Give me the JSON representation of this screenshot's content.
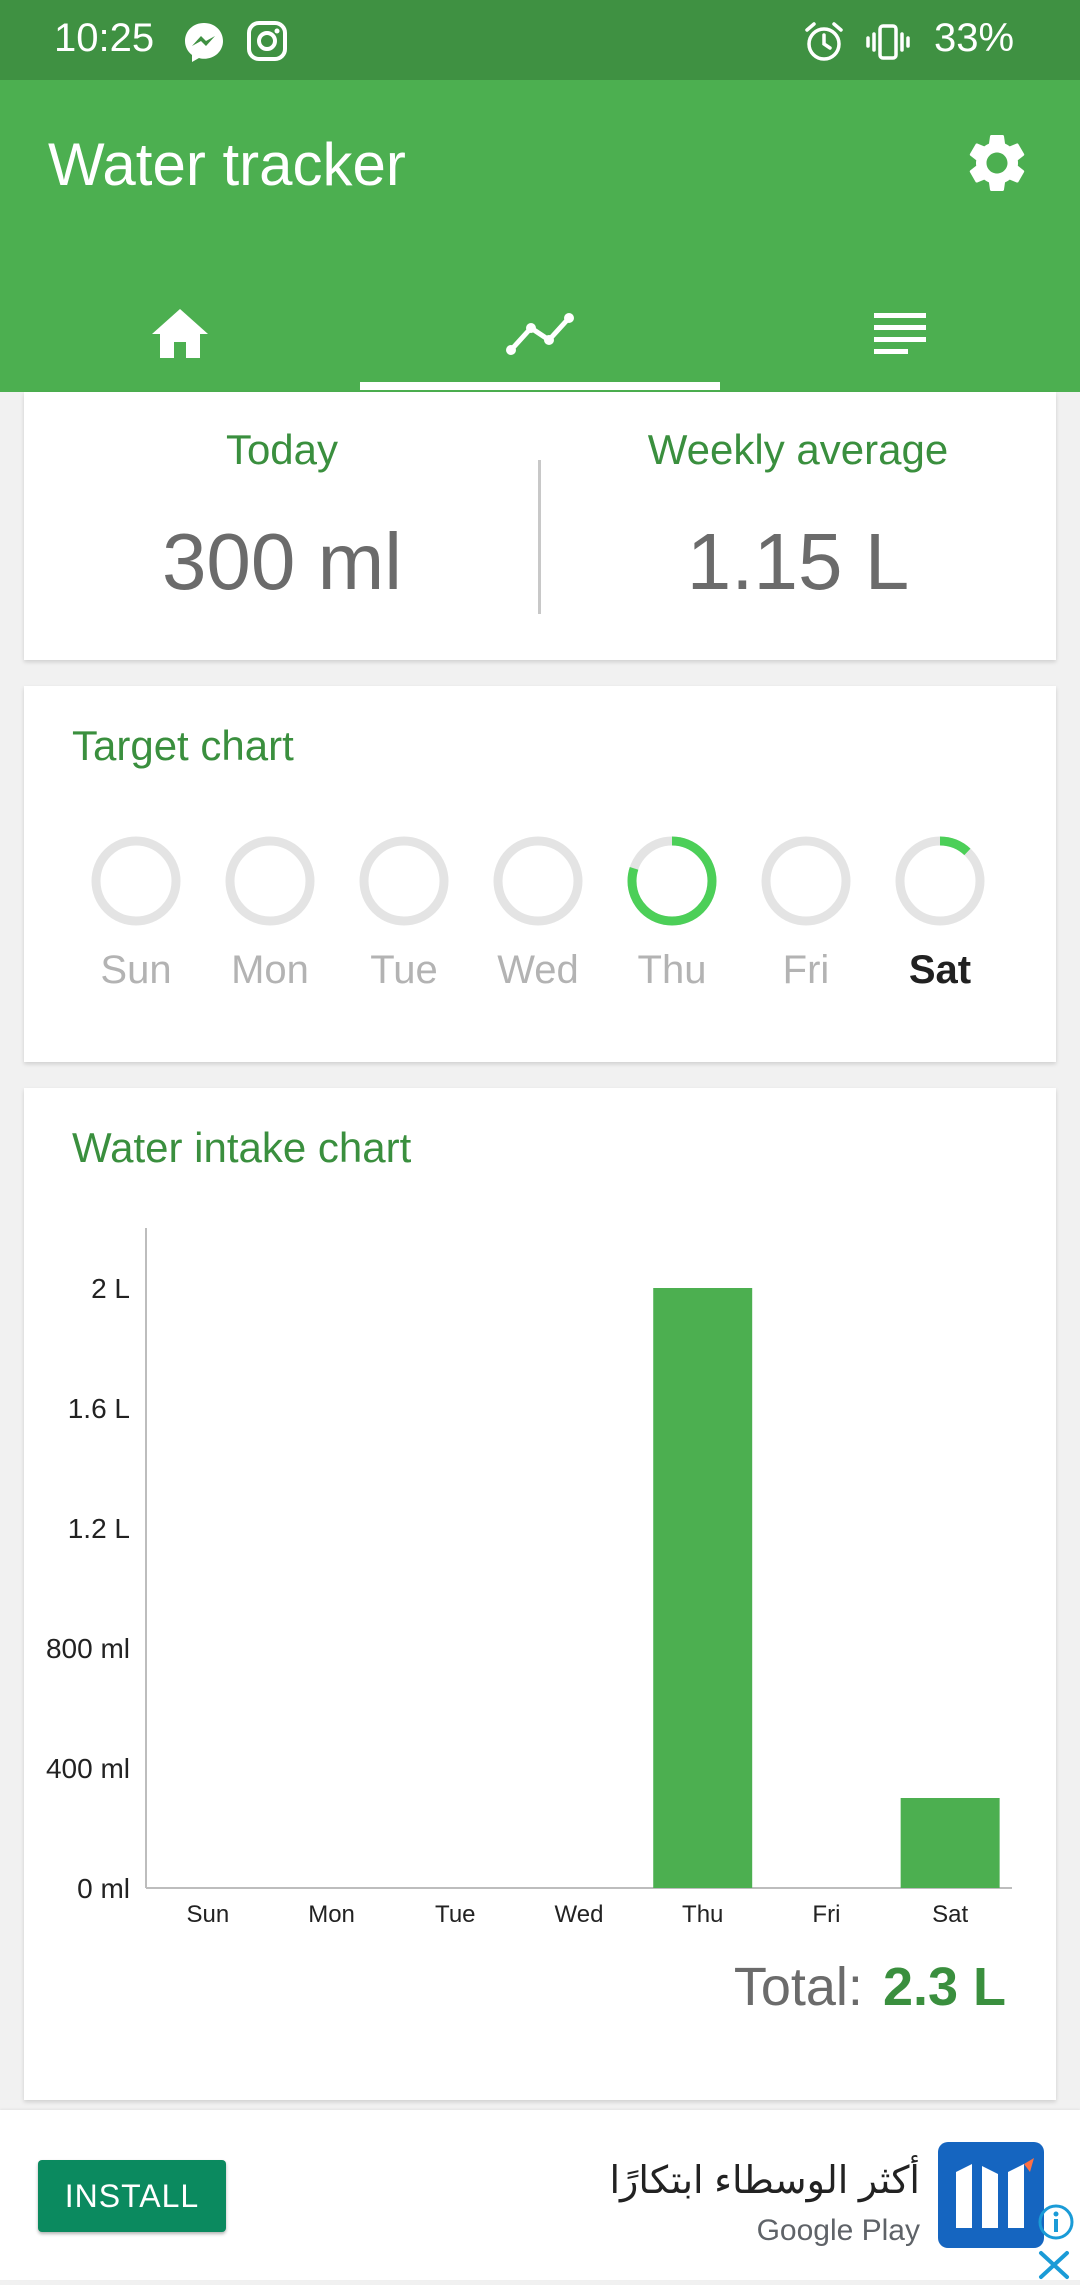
{
  "status_bar": {
    "time": "10:25",
    "battery": "33%",
    "icons": [
      "messenger-icon",
      "instagram-icon",
      "alarm-icon",
      "vibrate-icon"
    ]
  },
  "app_bar": {
    "title": "Water tracker",
    "settings_icon": "gear-icon",
    "tabs": [
      {
        "name": "home",
        "icon": "home-icon",
        "active": false
      },
      {
        "name": "stats",
        "icon": "trend-line-icon",
        "active": true
      },
      {
        "name": "log",
        "icon": "list-lines-icon",
        "active": false
      }
    ]
  },
  "summary": {
    "today_label": "Today",
    "today_value": "300 ml",
    "weekly_label": "Weekly average",
    "weekly_value": "1.15 L"
  },
  "target_chart": {
    "title": "Target chart",
    "days": [
      {
        "label": "Sun",
        "progress": 0,
        "current": false
      },
      {
        "label": "Mon",
        "progress": 0,
        "current": false
      },
      {
        "label": "Tue",
        "progress": 0,
        "current": false
      },
      {
        "label": "Wed",
        "progress": 0,
        "current": false
      },
      {
        "label": "Thu",
        "progress": 0.8,
        "current": false
      },
      {
        "label": "Fri",
        "progress": 0,
        "current": false
      },
      {
        "label": "Sat",
        "progress": 0.12,
        "current": true
      }
    ],
    "colors": {
      "progress": "#4ccf58",
      "track": "#e4e4e4"
    }
  },
  "intake_chart": {
    "title": "Water intake chart",
    "total_label": "Total:",
    "total_value": "2.3 L"
  },
  "chart_data": {
    "type": "bar",
    "categories": [
      "Sun",
      "Mon",
      "Tue",
      "Wed",
      "Thu",
      "Fri",
      "Sat"
    ],
    "values": [
      0,
      0,
      0,
      0,
      2000,
      0,
      300
    ],
    "y_unit": "ml",
    "ylim": [
      0,
      2200
    ],
    "y_ticks": [
      {
        "value": 0,
        "label": "0 ml"
      },
      {
        "value": 400,
        "label": "400 ml"
      },
      {
        "value": 800,
        "label": "800 ml"
      },
      {
        "value": 1200,
        "label": "1.2 L"
      },
      {
        "value": 1600,
        "label": "1.6 L"
      },
      {
        "value": 2000,
        "label": "2 L"
      }
    ],
    "grid": false,
    "bar_color": "#4caf50"
  },
  "ad": {
    "install_label": "INSTALL",
    "headline": "أكثر الوسطاء ابتكارًا",
    "store": "Google Play",
    "logo_icon": "broker-logo-icon",
    "info_icon": "info-icon",
    "close_icon": "close-icon"
  },
  "colors": {
    "primary": "#4caf50",
    "primary_dark": "#3f9142",
    "accent_text": "#3a8f3e"
  }
}
